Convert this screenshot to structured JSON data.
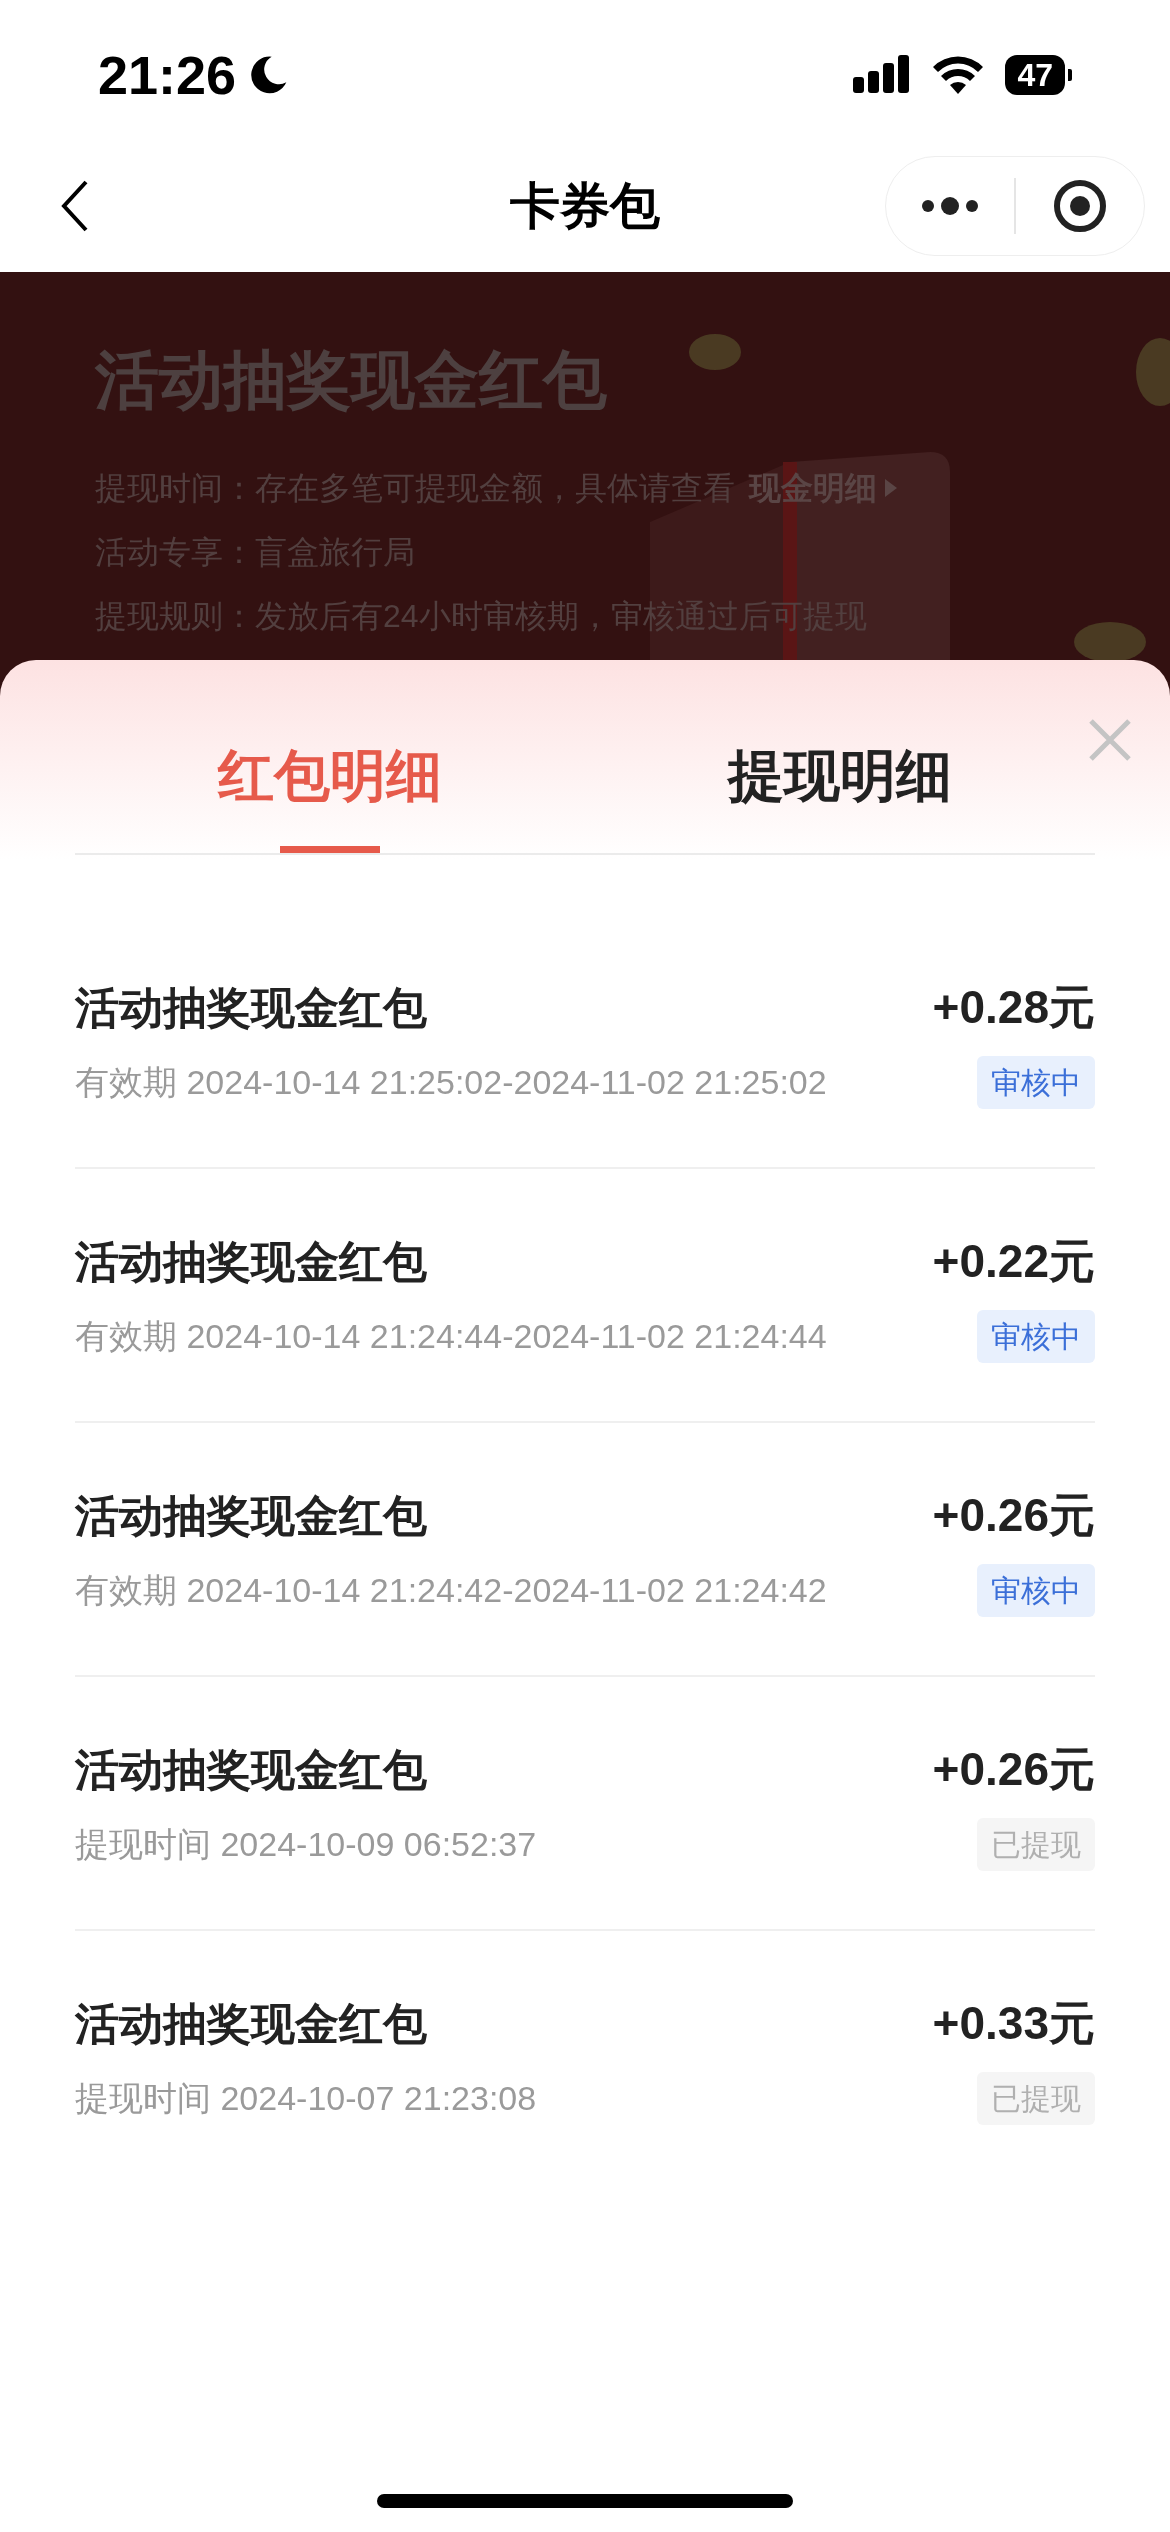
{
  "status_bar": {
    "time": "21:26",
    "battery": "47"
  },
  "nav_bar": {
    "title": "卡券包"
  },
  "banner": {
    "title": "活动抽奖现金红包",
    "lines": [
      {
        "label": "提现时间：",
        "text": "存在多笔可提现金额，具体请查看",
        "link": "现金明细"
      },
      {
        "label": "活动专享：",
        "text": "盲盒旅行局"
      },
      {
        "label": "提现规则：",
        "text": "发放后有24小时审核期，审核通过后可提现"
      }
    ]
  },
  "sheet": {
    "tabs": [
      {
        "label": "红包明细",
        "selected": true
      },
      {
        "label": "提现明细",
        "selected": false
      }
    ],
    "items": [
      {
        "title": "活动抽奖现金红包",
        "detail": "有效期 2024-10-14 21:25:02-2024-11-02 21:25:02",
        "amount": "+0.28元",
        "status": "审核中",
        "kind": "reviewing"
      },
      {
        "title": "活动抽奖现金红包",
        "detail": "有效期 2024-10-14 21:24:44-2024-11-02 21:24:44",
        "amount": "+0.22元",
        "status": "审核中",
        "kind": "reviewing"
      },
      {
        "title": "活动抽奖现金红包",
        "detail": "有效期 2024-10-14 21:24:42-2024-11-02 21:24:42",
        "amount": "+0.26元",
        "status": "审核中",
        "kind": "reviewing"
      },
      {
        "title": "活动抽奖现金红包",
        "detail": "提现时间 2024-10-09 06:52:37",
        "amount": "+0.26元",
        "status": "已提现",
        "kind": "withdrawn"
      },
      {
        "title": "活动抽奖现金红包",
        "detail": "提现时间 2024-10-07 21:23:08",
        "amount": "+0.33元",
        "status": "已提现",
        "kind": "withdrawn"
      }
    ]
  }
}
